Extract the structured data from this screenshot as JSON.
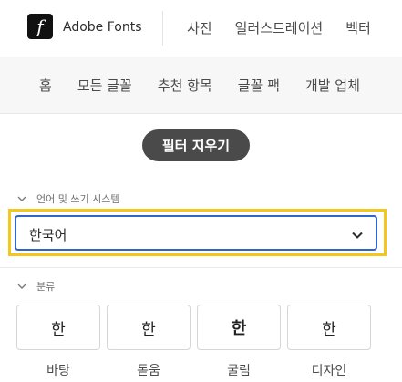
{
  "header": {
    "logo_glyph": "f",
    "brand": "Adobe Fonts",
    "nav": [
      "사진",
      "일러스트레이션",
      "벡터"
    ]
  },
  "subnav": {
    "items": [
      "홈",
      "모든 글꼴",
      "추천 항목",
      "글꼴 팩",
      "개발 업체"
    ]
  },
  "filters": {
    "clear_label": "필터 지우기",
    "language": {
      "header": "언어 및 쓰기 시스템",
      "selected": "한국어"
    },
    "classification": {
      "header": "분류",
      "cards": [
        {
          "sample": "한",
          "label": "바탕"
        },
        {
          "sample": "한",
          "label": "돋움"
        },
        {
          "sample": "한",
          "label": "굴림"
        },
        {
          "sample": "한",
          "label": "디자인"
        }
      ]
    }
  },
  "colors": {
    "highlight": "#f2c81e",
    "focus_border": "#2f66c7",
    "button_bg": "#4a4a4a"
  }
}
